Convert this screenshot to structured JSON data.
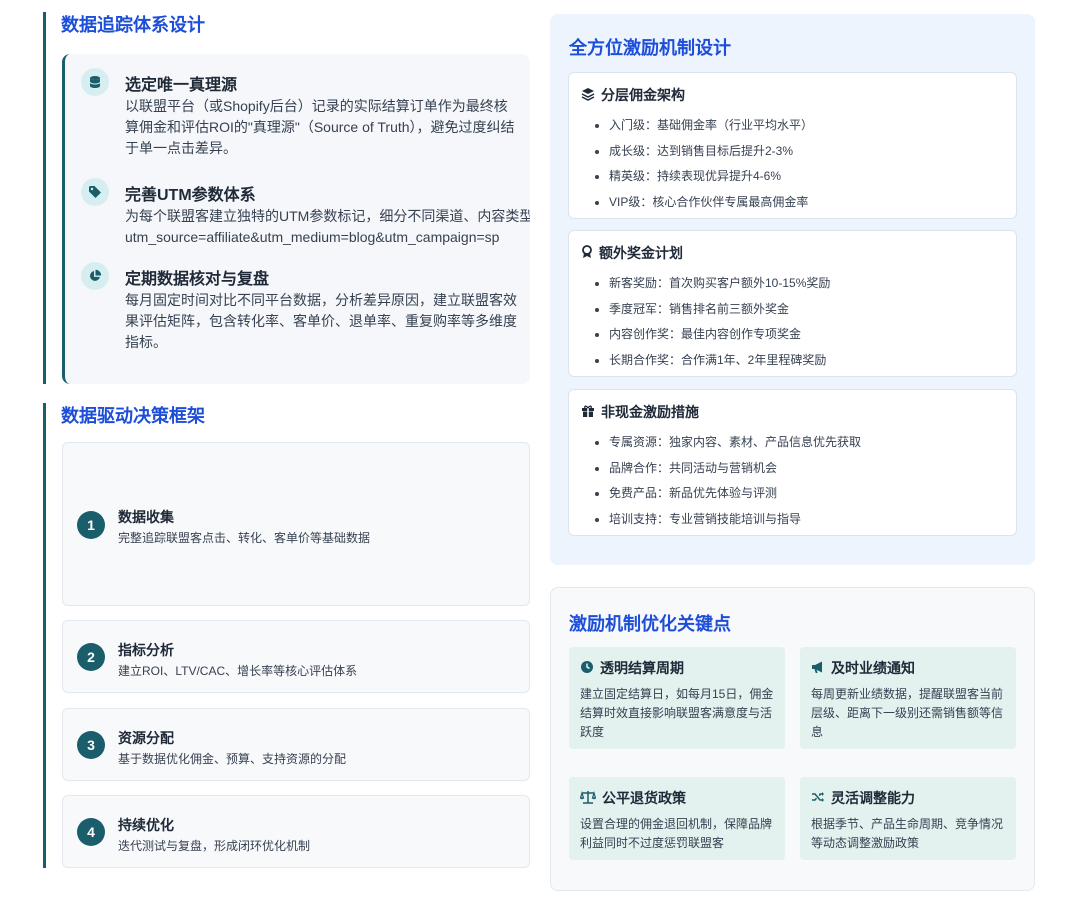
{
  "tracking": {
    "title": "数据追踪体系设计",
    "items": [
      {
        "title": "选定唯一真理源",
        "text": "以联盟平台（或Shopify后台）记录的实际结算订单作为最终核算佣金和评估ROI的\"真理源\"（Source of Truth），避免过度纠结于单一点击差异。",
        "icon": "database-icon"
      },
      {
        "title": "完善UTM参数体系",
        "text": "为每个联盟客建立独特的UTM参数标记，细分不同渠道、内容类型",
        "text2": "utm_source=affiliate&utm_medium=blog&utm_campaign=sp",
        "icon": "tag-icon"
      },
      {
        "title": "定期数据核对与复盘",
        "text": "每月固定时间对比不同平台数据，分析差异原因，建立联盟客效果评估矩阵，包含转化率、客单价、退单率、重复购率等多维度指标。",
        "icon": "pie-chart-icon"
      }
    ]
  },
  "decision": {
    "title": "数据驱动决策框架",
    "steps": [
      {
        "num": "1",
        "title": "数据收集",
        "desc": "完整追踪联盟客点击、转化、客单价等基础数据"
      },
      {
        "num": "2",
        "title": "指标分析",
        "desc": "建立ROI、LTV/CAC、增长率等核心评估体系"
      },
      {
        "num": "3",
        "title": "资源分配",
        "desc": "基于数据优化佣金、预算、支持资源的分配"
      },
      {
        "num": "4",
        "title": "持续优化",
        "desc": "迭代测试与复盘，形成闭环优化机制"
      }
    ]
  },
  "incentive": {
    "title": "全方位激励机制设计",
    "cards": [
      {
        "title": "分层佣金架构",
        "icon": "layers-icon",
        "items": [
          "入门级：基础佣金率（行业平均水平）",
          "成长级：达到销售目标后提升2-3%",
          "精英级：持续表现优异提升4-6%",
          "VIP级：核心合作伙伴专属最高佣金率"
        ]
      },
      {
        "title": "额外奖金计划",
        "icon": "award-icon",
        "items": [
          "新客奖励：首次购买客户额外10-15%奖励",
          "季度冠军：销售排名前三额外奖金",
          "内容创作奖：最佳内容创作专项奖金",
          "长期合作奖：合作满1年、2年里程碑奖励"
        ]
      },
      {
        "title": "非现金激励措施",
        "icon": "gift-icon",
        "items": [
          "专属资源：独家内容、素材、产品信息优先获取",
          "品牌合作：共同活动与营销机会",
          "免费产品：新品优先体验与评测",
          "培训支持：专业营销技能培训与指导"
        ]
      }
    ]
  },
  "optimization": {
    "title": "激励机制优化关键点",
    "boxes": [
      {
        "title": "透明结算周期",
        "icon": "clock-icon",
        "text": "建立固定结算日，如每月15日，佣金结算时效直接影响联盟客满意度与活跃度"
      },
      {
        "title": "及时业绩通知",
        "icon": "megaphone-icon",
        "text": "每周更新业绩数据，提醒联盟客当前层级、距离下一级别还需销售额等信息"
      },
      {
        "title": "公平退货政策",
        "icon": "balance-scale-icon",
        "text": "设置合理的佣金退回机制，保障品牌利益同时不过度惩罚联盟客"
      },
      {
        "title": "灵活调整能力",
        "icon": "shuffle-icon",
        "text": "根据季节、产品生命周期、竞争情况等动态调整激励政策"
      }
    ]
  },
  "colors": {
    "accent": "#1d4ed8",
    "teal": "#1b5e6b",
    "panel_bg": "#edf4fe",
    "mint": "#e3f1ef"
  }
}
